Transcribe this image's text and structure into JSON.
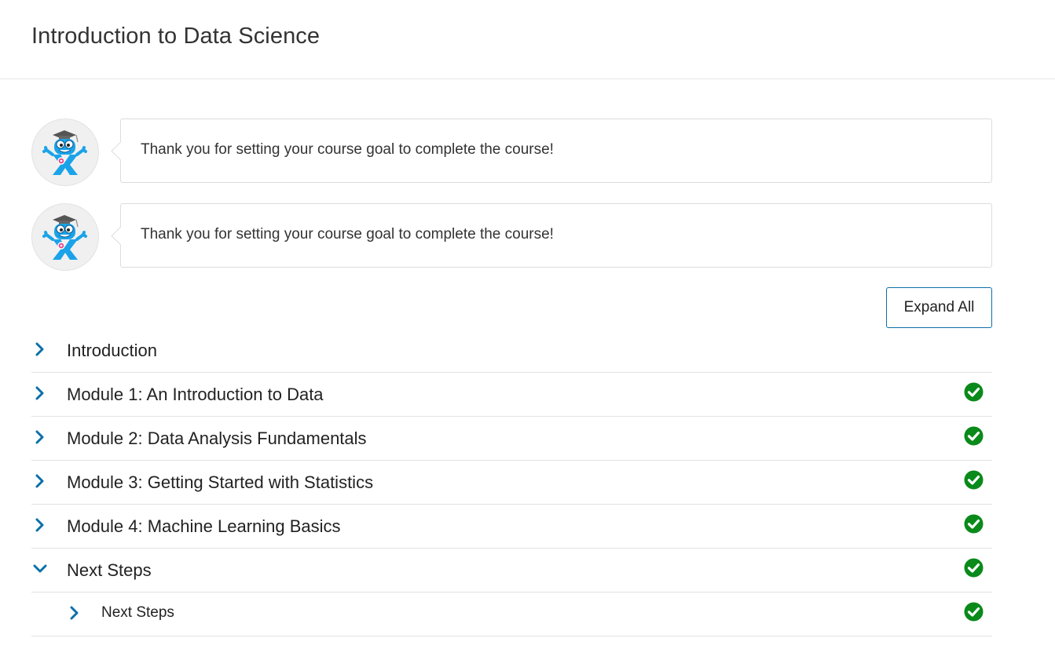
{
  "page": {
    "title": "Introduction to Data Science"
  },
  "messages": [
    {
      "text": "Thank you for setting your course goal to complete the course!",
      "avatar": "mascot-icon"
    },
    {
      "text": "Thank you for setting your course goal to complete the course!",
      "avatar": "mascot-icon"
    }
  ],
  "controls": {
    "expand_all_label": "Expand All"
  },
  "outline": [
    {
      "label": "Introduction",
      "expanded": false,
      "complete": false
    },
    {
      "label": "Module 1: An Introduction to Data",
      "expanded": false,
      "complete": true
    },
    {
      "label": "Module 2: Data Analysis Fundamentals",
      "expanded": false,
      "complete": true
    },
    {
      "label": "Module 3: Getting Started with Statistics",
      "expanded": false,
      "complete": true
    },
    {
      "label": "Module 4: Machine Learning Basics",
      "expanded": false,
      "complete": true
    },
    {
      "label": "Next Steps",
      "expanded": true,
      "complete": true,
      "children": [
        {
          "label": "Next Steps",
          "expanded": false,
          "complete": true
        }
      ]
    }
  ],
  "colors": {
    "accent": "#0a70a8",
    "complete": "#0a8a1a",
    "chevron": "#0a70a8"
  },
  "icons": {
    "collapsed": "chevron-right-icon",
    "expanded": "chevron-down-icon",
    "complete": "check-circle-icon"
  }
}
